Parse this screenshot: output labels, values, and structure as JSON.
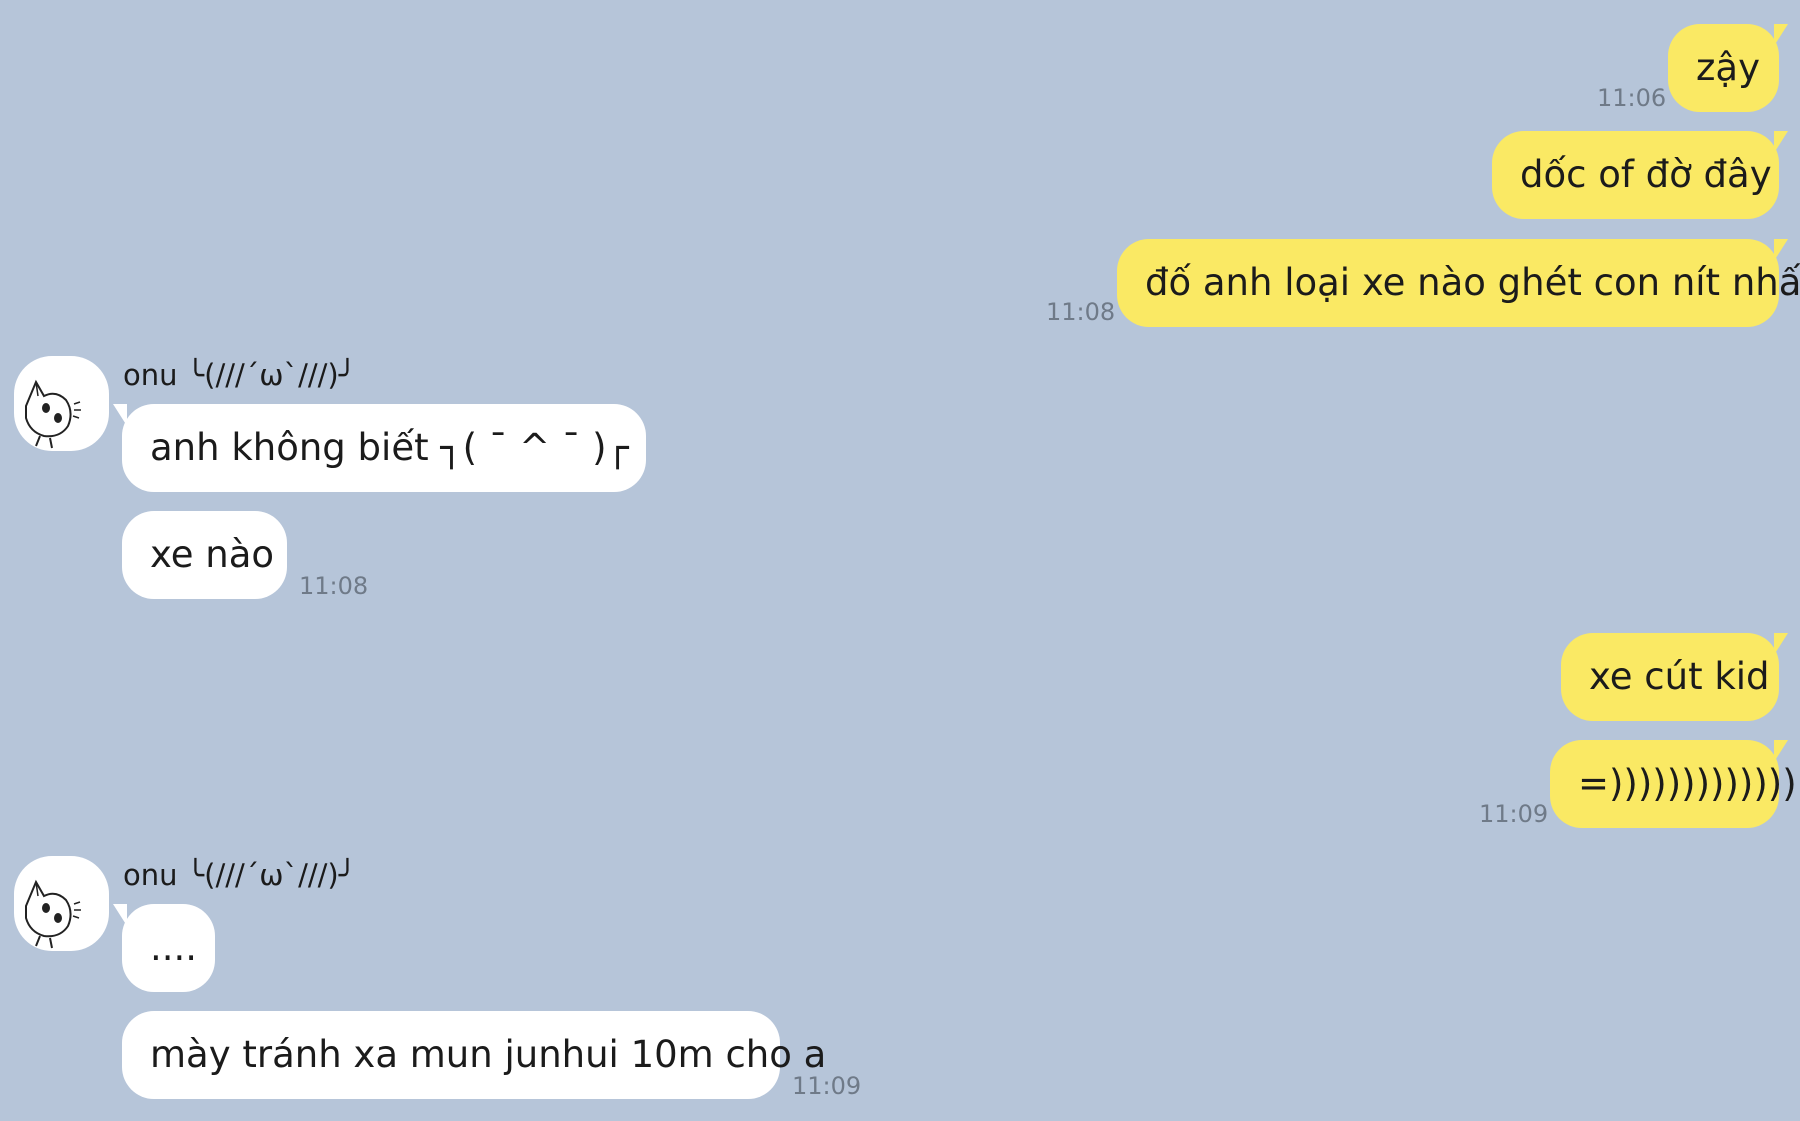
{
  "messages": [
    {
      "dir": "out",
      "text": "zậy",
      "time": "11:06"
    },
    {
      "dir": "out",
      "text": "dốc of đờ đây"
    },
    {
      "dir": "out",
      "text": "đố anh loại xe nào ghét con nít nhất",
      "time": "11:08"
    },
    {
      "dir": "in",
      "sender": "onu ╰(///´ω`///)╯",
      "text": "anh không biết ┐( ˉ ^ ˉ )┌"
    },
    {
      "dir": "in",
      "text": "xe nào",
      "time": "11:08"
    },
    {
      "dir": "out",
      "text": "xe cút kid"
    },
    {
      "dir": "out",
      "text": "=)))))))))))))",
      "time": "11:09"
    },
    {
      "dir": "in",
      "sender": "onu ╰(///´ω`///)╯",
      "text": "...."
    },
    {
      "dir": "in",
      "text": "mày tránh xa mun junhui 10m cho a",
      "time": "11:09"
    }
  ],
  "colors": {
    "background": "#b6c5d9",
    "outgoing_bubble": "#fae964",
    "incoming_bubble": "#ffffff",
    "timestamp": "#6f7a88"
  },
  "icons": {
    "avatar": "cat-sketch-avatar-icon"
  }
}
